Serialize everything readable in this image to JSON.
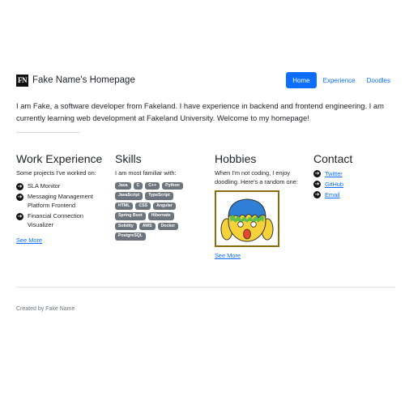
{
  "brand": {
    "logo_text": "FN",
    "name": "Fake Name's Homepage"
  },
  "nav": {
    "items": [
      {
        "label": "Home",
        "active": true
      },
      {
        "label": "Experience",
        "active": false
      },
      {
        "label": "Doodles",
        "active": false
      }
    ]
  },
  "intro": "I am Fake, a software developer from Fakeland. I have experience in backend and frontend engineering. I am currently learning web development at Fakeland University. Welcome to my homepage!",
  "work": {
    "title": "Work Experience",
    "lead": "Some projects I've worked on:",
    "projects": [
      "SLA Monitor",
      "Messaging Management Platform Frontend",
      "Financial Connection Visualizer"
    ],
    "see_more": "See More"
  },
  "skills": {
    "title": "Skills",
    "lead": "I am most familiar with:",
    "tags": [
      "Java",
      "C",
      "C++",
      "Python",
      "JavaScript",
      "TypeScript",
      "HTML",
      "CSS",
      "Angular",
      "Spring Boot",
      "Hibernate",
      "Solidity",
      "AWS",
      "Docker",
      "PostgreSQL"
    ]
  },
  "hobbies": {
    "title": "Hobbies",
    "lead": "When I'm not coding, I enjoy doodling. Here's a random one:",
    "see_more": "See More"
  },
  "contact": {
    "title": "Contact",
    "links": [
      "Twitter",
      "GitHub",
      "Email"
    ]
  },
  "footer": "Created by Fake Name",
  "colors": {
    "accent": "#0d6efd",
    "badge": "#6c757d",
    "frame": "#8b6a12"
  }
}
